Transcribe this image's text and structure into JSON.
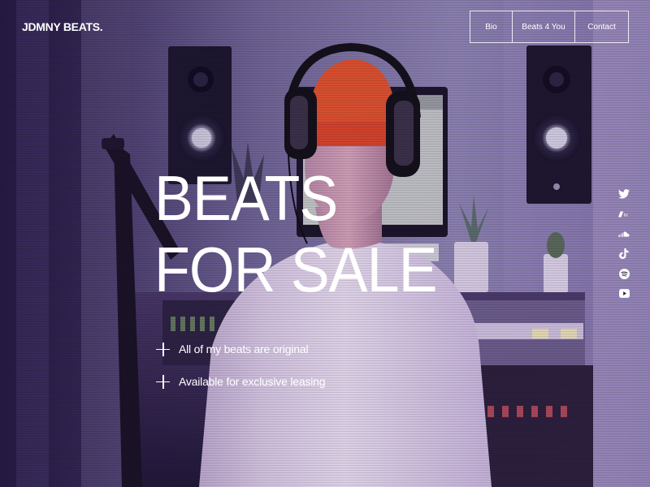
{
  "brand": {
    "logo": "JDMNY BEATS."
  },
  "nav": {
    "items": [
      {
        "label": "Bio"
      },
      {
        "label": "Beats 4 You"
      },
      {
        "label": "Contact"
      }
    ]
  },
  "hero": {
    "title_line1": "BEATS",
    "title_line2": "FOR SALE",
    "features": [
      {
        "text": "All of my beats are original",
        "icon": "plus-icon"
      },
      {
        "text": "Available for exclusive leasing",
        "icon": "plus-icon"
      }
    ]
  },
  "social": {
    "icons": [
      "twitter-icon",
      "bandcamp-icon",
      "soundcloud-icon",
      "tiktok-icon",
      "spotify-icon",
      "youtube-icon"
    ]
  },
  "colors": {
    "text": "#ffffff",
    "background_tint": "#2a1c4a",
    "hat_orange": "#e0522d"
  },
  "background": {
    "scene": "studio-photo-background"
  }
}
